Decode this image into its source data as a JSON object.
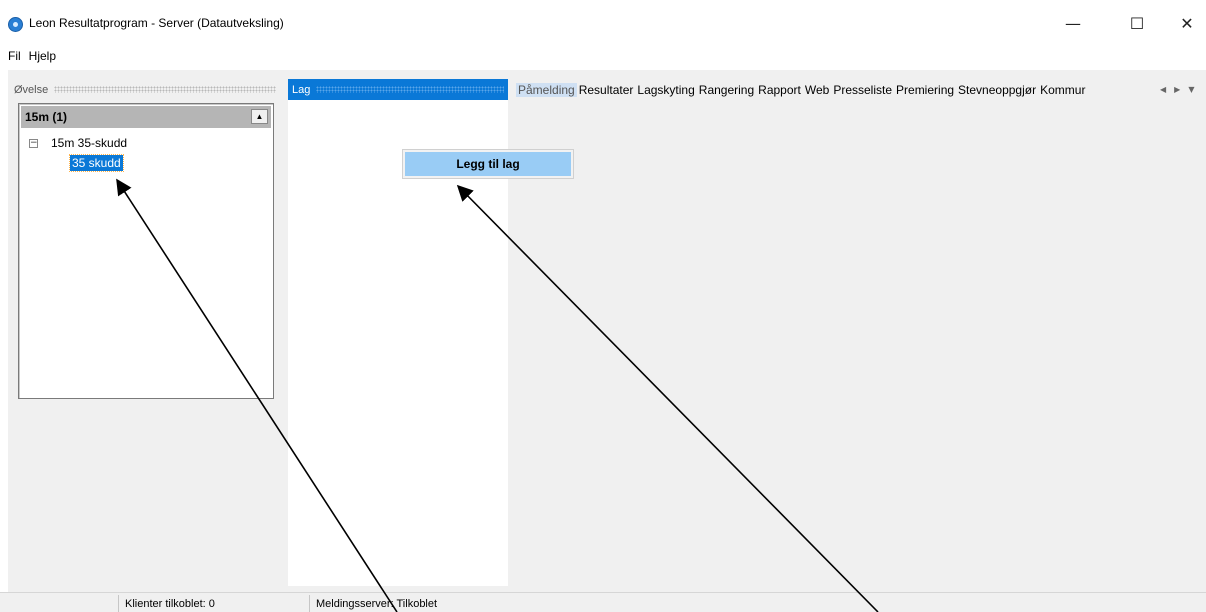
{
  "window": {
    "title": "Leon Resultatprogram - Server (Datautveksling)",
    "minimize_glyph": "—",
    "maximize_glyph": "☐",
    "close_glyph": "✕"
  },
  "menu": {
    "items": [
      "Fil",
      "Hjelp"
    ]
  },
  "ovelse_panel": {
    "header": "Øvelse",
    "group": {
      "title": "15m (1)",
      "collapse_glyph": "▲"
    },
    "tree": {
      "expander": "−",
      "node": "15m 35-skudd",
      "child": "35 skudd"
    }
  },
  "lag_panel": {
    "header": "Lag"
  },
  "context_menu": {
    "item": "Legg til lag"
  },
  "tabs": [
    "Påmelding",
    "Resultater",
    "Lagskyting",
    "Rangering",
    "Rapport",
    "Web",
    "Presseliste",
    "Premiering",
    "Stevneoppgjør",
    "Kommur"
  ],
  "tab_scroll": {
    "left": "◀",
    "right": "▶",
    "menu": "▼"
  },
  "status": {
    "clients": "Klienter tilkoblet: 0",
    "message_server": "Meldingsserver: Tilkoblet"
  },
  "colors": {
    "accent": "#0a78d7",
    "context_highlight": "#99ccf5"
  },
  "icons": [
    "app-icon",
    "tree-expander-icon",
    "collapse-icon",
    "annotation-arrow"
  ]
}
